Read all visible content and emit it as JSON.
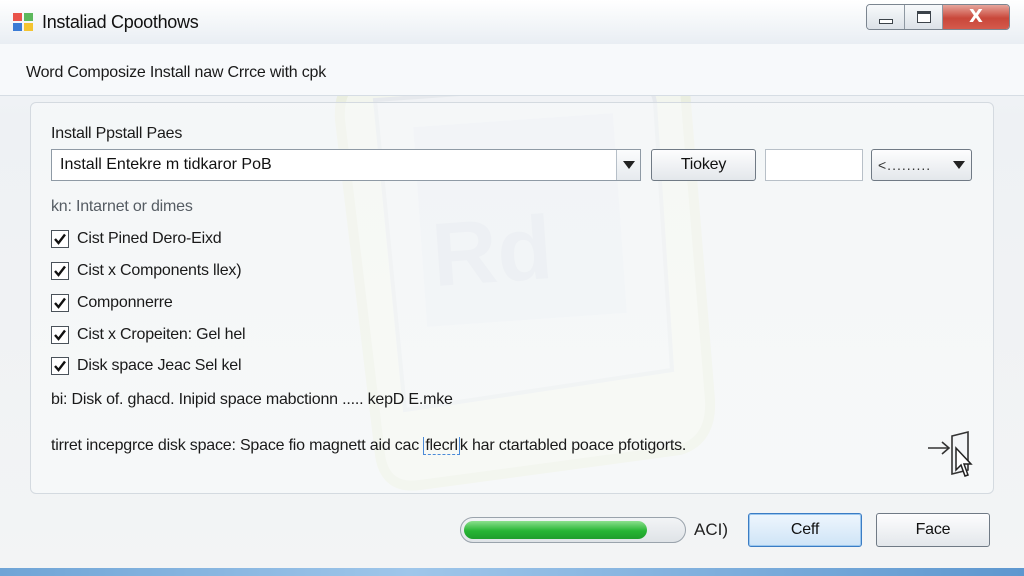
{
  "window": {
    "title": "Instaliad Cpoothows",
    "close_glyph": "X"
  },
  "header": {
    "subtitle": "Word Composize Install naw Crrce with cpk"
  },
  "panel": {
    "section_label": "Install Ppstall Paes",
    "combo_value": "Install Entekre m tidkaror PoB",
    "key_button": "Tiokey",
    "mini_combo_dots": "<.........",
    "group_label": "kn: Intarnet or dimes",
    "checkboxes": [
      {
        "label": "Cist Pined Dero-Eixd",
        "checked": true
      },
      {
        "label": "Cist x Components llex)",
        "checked": true
      },
      {
        "label": "Componnerre",
        "checked": true
      },
      {
        "label": "Cist x Cropeiten: Gel hel",
        "checked": true
      },
      {
        "label": "Disk space Jeac Sel kel",
        "checked": true
      }
    ],
    "disk_line": "bi: Disk of. ghacd. Inipid space mabctionn ..... kepD E.mke",
    "status_line_pre": "tirret incepgrce disk space: Space fio magnett aid cac ",
    "status_line_link": "flecrl",
    "status_line_post": "k har ctartabled poace pfotigorts."
  },
  "footer": {
    "progress_fraction": 0.84,
    "progress_label": "ACI)",
    "primary_button": "Ceff",
    "secondary_button": "Face"
  },
  "colors": {
    "progress": "#27b534",
    "close": "#c9473a",
    "accent": "#3b7cc4"
  },
  "icons": {
    "app": "installer-icon",
    "export": "export-arrow-icon",
    "watermark": "installer-watermark"
  }
}
